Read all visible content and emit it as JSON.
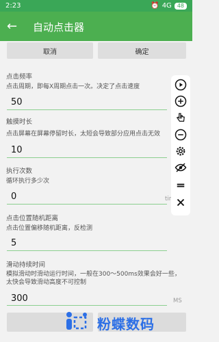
{
  "status_bar": {
    "time": "2:23",
    "signal": "4G",
    "battery": "48"
  },
  "header": {
    "title": "自动点击器"
  },
  "actions": {
    "cancel_label": "取消",
    "confirm_label": "确定"
  },
  "sections": [
    {
      "title": "点击频率",
      "description": "点击周期，即每X周期点击一次。决定了点击速度",
      "value": "50",
      "unit": ""
    },
    {
      "title": "触摸时长",
      "description": "点击屏幕在屏幕停留时长，太短会导致部分应用点击无效",
      "value": "10",
      "unit": ""
    },
    {
      "title": "执行次数",
      "description": "循环执行多少次",
      "value": "0",
      "unit": "times"
    },
    {
      "title": "点击位置随机距离",
      "description": "点击位置偏移随机距离，反检测",
      "value": "5",
      "unit": ""
    },
    {
      "title": "滑动持续时间",
      "description": "模拟滑动时滑动运行时间，一般在300～500ms效果会好一些，太快会导致滑动高度不可控制",
      "value": "300",
      "unit": "MS"
    }
  ],
  "toolbar_icons": [
    "play-icon",
    "add-icon",
    "hand-pointer-icon",
    "remove-icon",
    "settings-icon",
    "hide-icon",
    "menu-icon",
    "close-icon"
  ],
  "watermark": {
    "brand": "粉蝶数码"
  },
  "colors": {
    "accent": "#4caf50",
    "statusbar": "#3aa757",
    "brand": "#2c6fe6"
  }
}
